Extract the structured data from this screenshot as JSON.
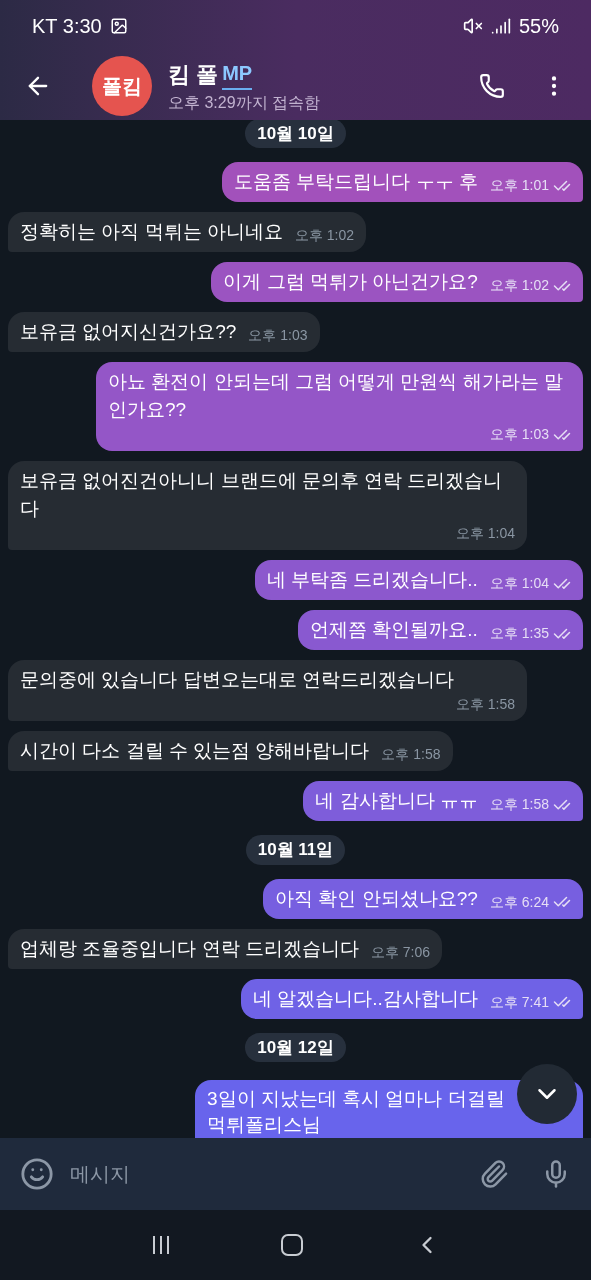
{
  "status_bar": {
    "carrier_time": "KT 3:30",
    "battery": "55%"
  },
  "header": {
    "avatar_text": "폴킴",
    "name": "킴 폴",
    "badge": "MP",
    "last_seen": "오후 3:29까지 접속함"
  },
  "messages": [
    {
      "kind": "date",
      "text": "10월 10일"
    },
    {
      "kind": "out",
      "text": "도움좀 부탁드립니다 ㅜㅜ 후",
      "time": "오후 1:01",
      "read": true
    },
    {
      "kind": "in",
      "text": "정확히는 아직 먹튀는 아니네요",
      "time": "오후 1:02"
    },
    {
      "kind": "out",
      "text": "이게 그럼 먹튀가 아닌건가요?",
      "time": "오후 1:02",
      "read": true
    },
    {
      "kind": "in",
      "text": "보유금 없어지신건가요??",
      "time": "오후 1:03"
    },
    {
      "kind": "out",
      "text": "아뇨 환전이 안되는데 그럼 어떻게 만원씩 해가라는 말인가요??",
      "time": "오후 1:03",
      "read": true
    },
    {
      "kind": "in",
      "text": "보유금 없어진건아니니 브랜드에 문의후 연락 드리겠습니다",
      "time": "오후 1:04"
    },
    {
      "kind": "out",
      "text": "네 부탁좀 드리겠습니다..",
      "time": "오후 1:04",
      "read": true
    },
    {
      "kind": "out",
      "text": "언제쯤 확인될까요..",
      "time": "오후 1:35",
      "read": true
    },
    {
      "kind": "in",
      "text": "문의중에 있습니다 답변오는대로 연락드리겠습니다",
      "time": "오후 1:58"
    },
    {
      "kind": "in",
      "text": "시간이 다소 걸릴 수 있는점 양해바랍니다",
      "time": "오후 1:58"
    },
    {
      "kind": "out",
      "text": "네 감사합니다 ㅠㅠ",
      "time": "오후 1:58",
      "read": true
    },
    {
      "kind": "date",
      "text": "10월 11일"
    },
    {
      "kind": "out",
      "text": "아직 확인 안되셨나요??",
      "time": "오후 6:24",
      "read": true
    },
    {
      "kind": "in",
      "text": "업체랑 조율중입니다 연락 드리겠습니다",
      "time": "오후 7:06"
    },
    {
      "kind": "out",
      "text": "네 알겠습니다..감사합니다",
      "time": "오후 7:41",
      "read": true
    },
    {
      "kind": "date",
      "text": "10월 12일"
    },
    {
      "kind": "cut",
      "lines": [
        "3일이 지났는데 혹시 얼마나 더걸릴",
        "먹튀폴리스님"
      ]
    }
  ],
  "input": {
    "placeholder": "메시지"
  }
}
